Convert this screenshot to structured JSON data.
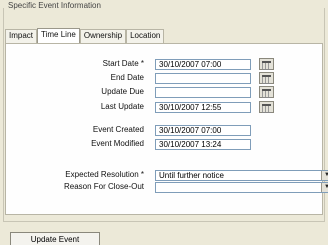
{
  "group": {
    "title": "Specific Event Information"
  },
  "tabs": [
    {
      "label": "Impact",
      "active": false
    },
    {
      "label": "Time Line",
      "active": true
    },
    {
      "label": "Ownership",
      "active": false
    },
    {
      "label": "Location",
      "active": false
    }
  ],
  "fields": {
    "start_date": {
      "label": "Start Date *",
      "value": "30/10/2007 07:00"
    },
    "end_date": {
      "label": "End Date",
      "value": ""
    },
    "update_due": {
      "label": "Update Due",
      "value": ""
    },
    "last_update": {
      "label": "Last Update",
      "value": "30/10/2007 12:55"
    },
    "event_created": {
      "label": "Event Created",
      "value": "30/10/2007 07:00"
    },
    "event_modified": {
      "label": "Event Modified",
      "value": "30/10/2007 13:24"
    },
    "expected_resolution": {
      "label": "Expected Resolution *",
      "value": "Until further notice"
    },
    "reason_close_out": {
      "label": "Reason For Close-Out",
      "value": ""
    }
  },
  "icons": {
    "calendar": "calendar-icon",
    "dropdown": "chevron-down-icon"
  },
  "actions": {
    "update_event": "Update Event"
  }
}
